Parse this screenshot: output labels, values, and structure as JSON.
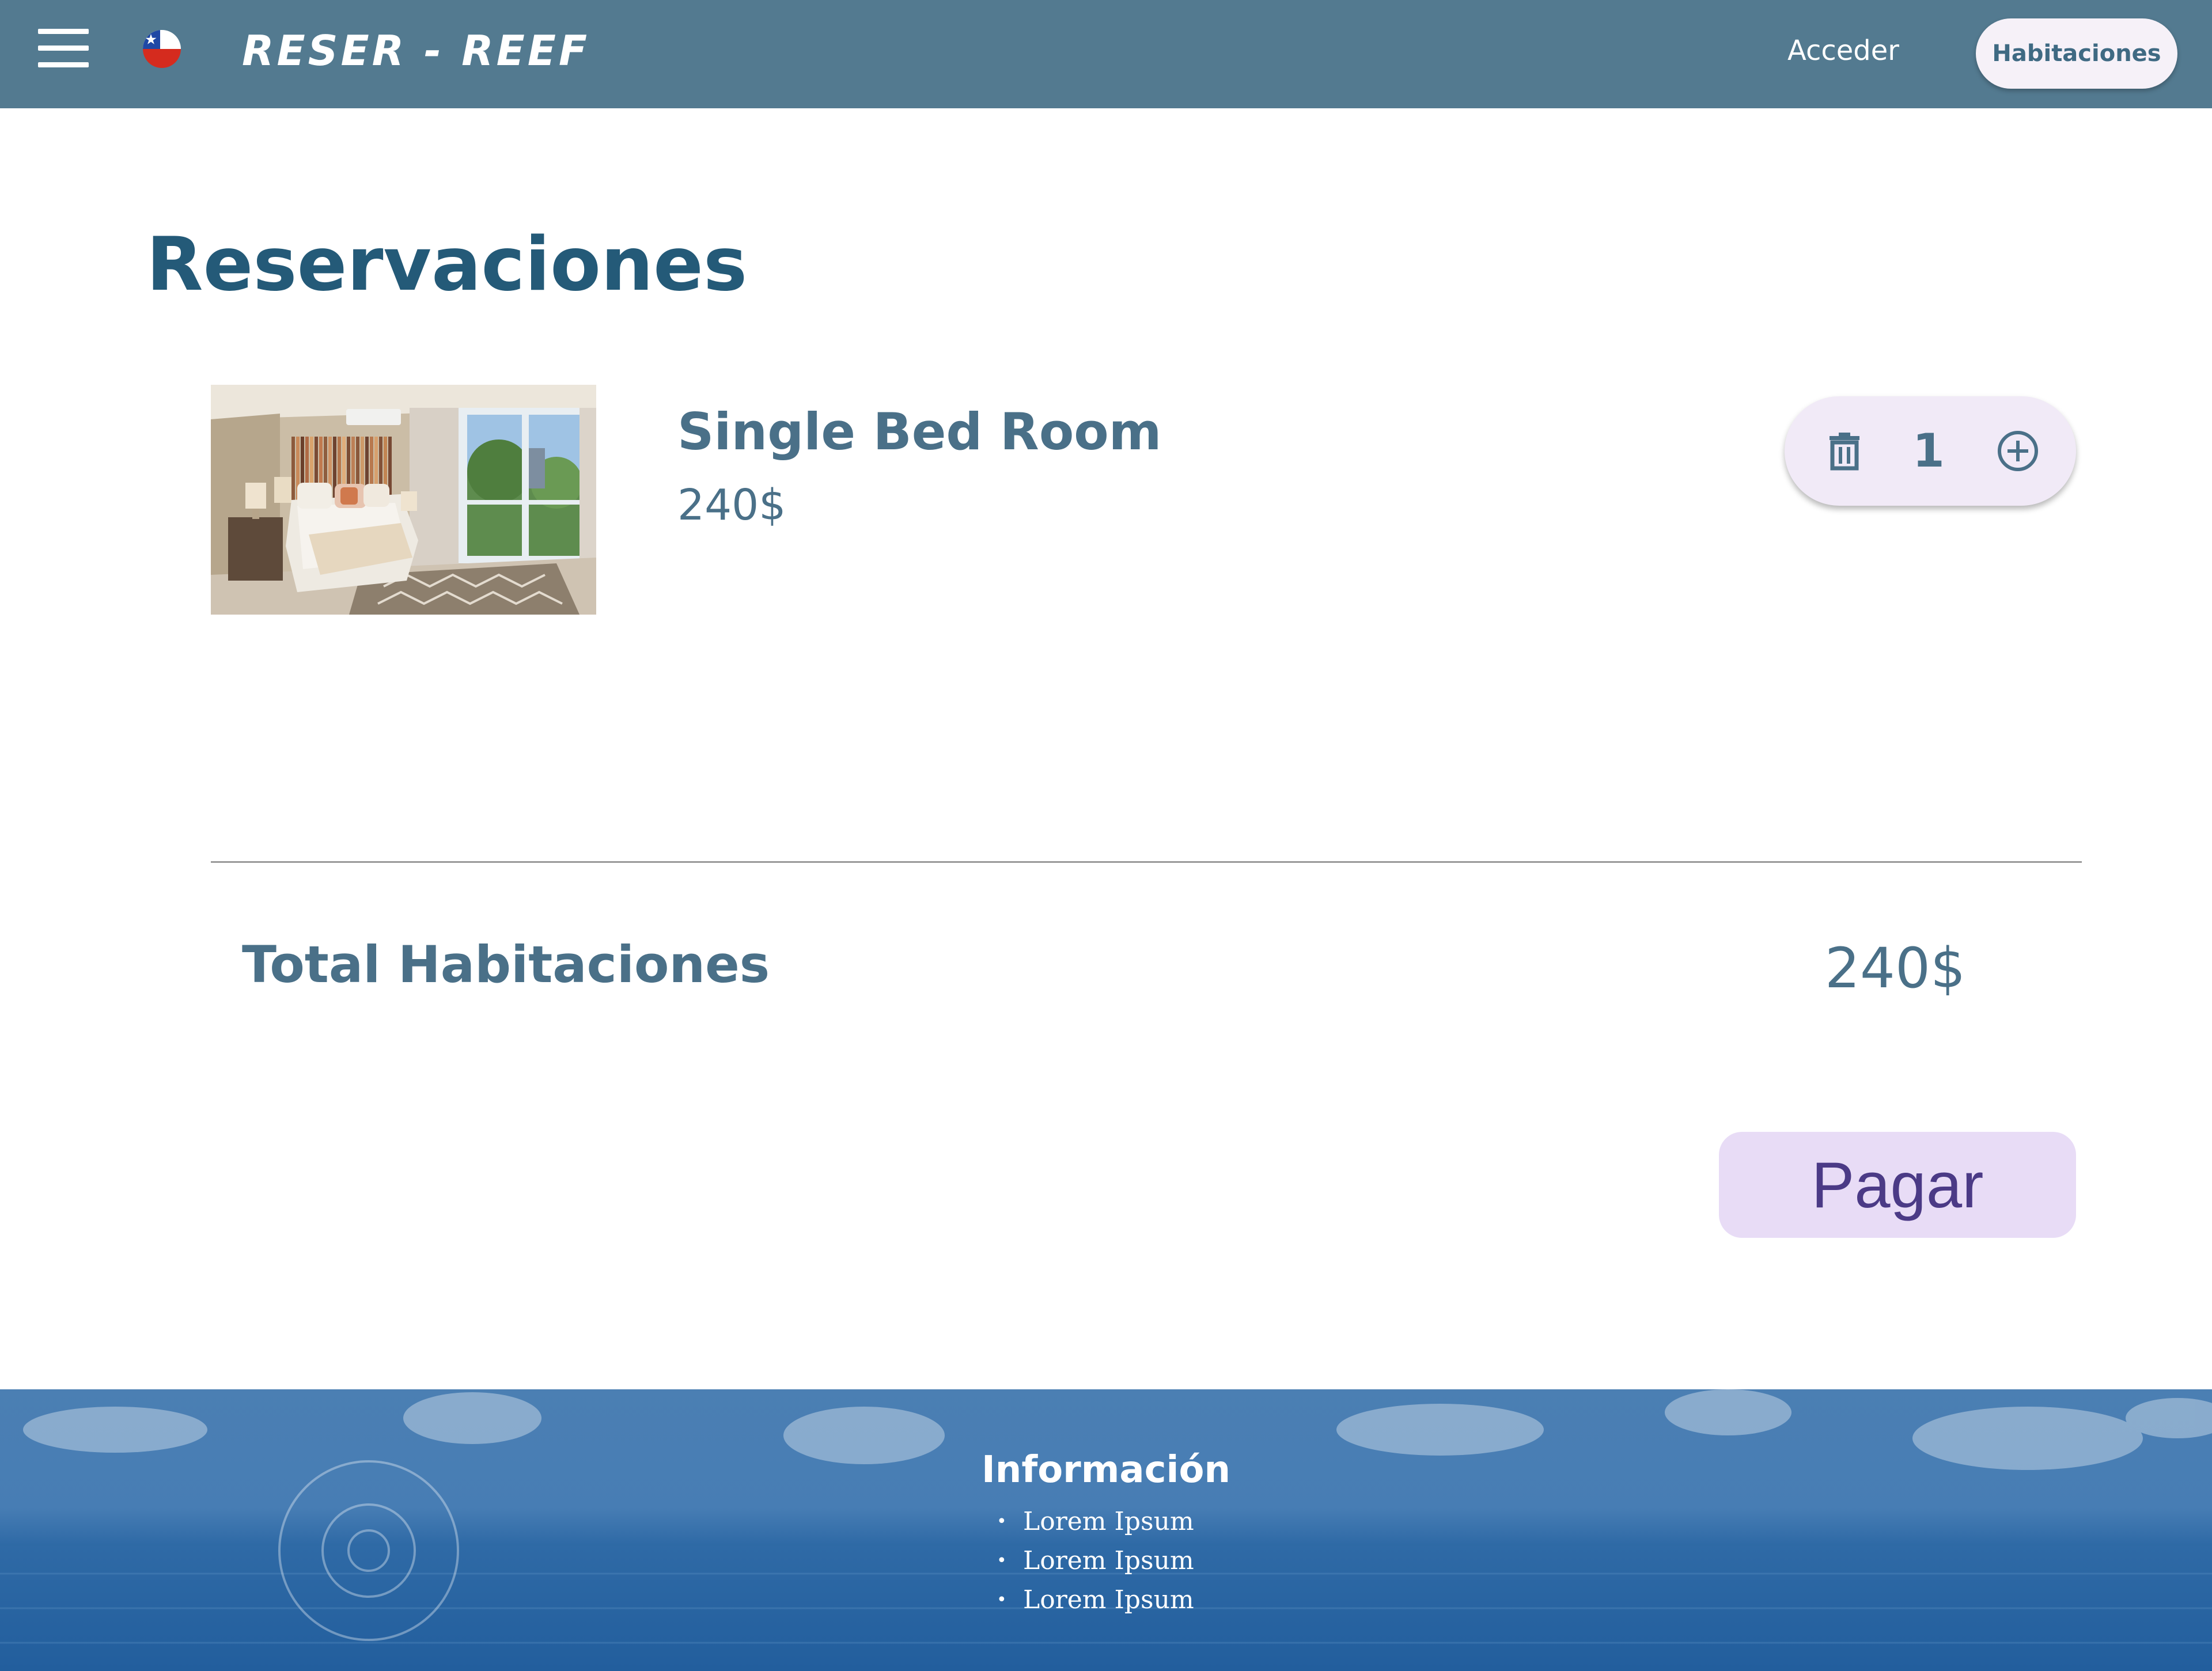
{
  "header": {
    "brand": "RESER - REEF",
    "login_label": "Acceder",
    "rooms_button_label": "Habitaciones",
    "menu_icon": "hamburger-menu-icon",
    "language_icon": "chile-flag-icon"
  },
  "main": {
    "title": "Reservaciones",
    "cart_items": [
      {
        "name": "Single Bed Room",
        "price": "240$",
        "quantity": "1",
        "image": "bedroom-photo",
        "delete_icon": "trash-icon",
        "add_icon": "plus-circle-icon"
      }
    ],
    "total_label": "Total Habitaciones",
    "total_value": "240$",
    "pay_label": "Pagar"
  },
  "footer": {
    "title": "Información",
    "items": [
      "Lorem Ipsum",
      "Lorem Ipsum",
      "Lorem Ipsum"
    ]
  },
  "colors": {
    "header_bg": "#537a90",
    "title_text": "#245a78",
    "body_text": "#4a7088",
    "pay_button_bg": "#e8dcf6",
    "pay_button_text": "#4b3a86"
  }
}
